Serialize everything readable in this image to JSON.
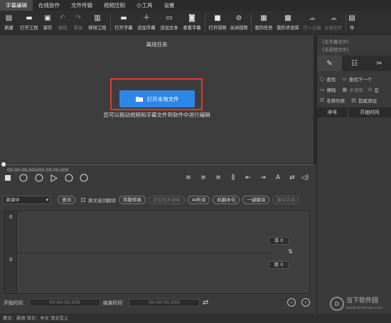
{
  "menu": [
    "字幕编辑",
    "在线协作",
    "文件传输",
    "视频压制",
    "小工具",
    "设置"
  ],
  "toolbar": [
    {
      "label": "新建",
      "icon": "new-file-icon"
    },
    {
      "label": "打开工程",
      "icon": "open-folder-icon"
    },
    {
      "label": "保存",
      "icon": "save-icon"
    },
    {
      "label": "撤销",
      "icon": "undo-icon",
      "disabled": true
    },
    {
      "label": "重做",
      "icon": "redo-icon",
      "disabled": true
    },
    {
      "label": "移除工程",
      "icon": "trash-icon"
    },
    {
      "label": "打开字幕",
      "icon": "open-subtitle-icon"
    },
    {
      "label": "追加字幕",
      "icon": "add-subtitle-icon"
    },
    {
      "label": "追加文本",
      "icon": "add-text-icon"
    },
    {
      "label": "查看字幕",
      "icon": "view-subtitle-icon"
    },
    {
      "label": "打开视频",
      "icon": "video-camera-icon"
    },
    {
      "label": "关闭视频",
      "icon": "close-video-icon"
    },
    {
      "label": "我的任务",
      "icon": "task-icon"
    },
    {
      "label": "我的术语库",
      "icon": "glossary-icon"
    },
    {
      "label": "存入云端",
      "icon": "cloud-upload-icon",
      "disabled": true
    },
    {
      "label": "云端文件",
      "icon": "cloud-file-icon",
      "disabled": true
    },
    {
      "label": "导",
      "icon": "export-icon"
    }
  ],
  "preview": {
    "title": "离线任务",
    "open_button": "打开本地文件",
    "hint": "您可以拖动视频和字幕文件到软件中进行编辑"
  },
  "timeline": {
    "time": "00:00:00,000/00:00:00,000"
  },
  "translate": {
    "mode": "英译中",
    "query": "查词",
    "checkbox_label": "原文选词翻译",
    "buttons": [
      {
        "label": "简繁转换",
        "disabled": false
      },
      {
        "label": "添加到术语库",
        "disabled": true
      },
      {
        "label": "AI听译",
        "disabled": false
      },
      {
        "label": "机翻本句",
        "disabled": false
      },
      {
        "label": "一键翻译",
        "disabled": false
      },
      {
        "label": "翻译完成",
        "disabled": true
      }
    ]
  },
  "editor": {
    "top_index": "0",
    "bottom_index": "0",
    "translation_badge": "译 0",
    "original_badge": "原 0"
  },
  "timerow": {
    "start_label": "开始时间",
    "start_value": "00:00:00,000",
    "end_label": "结束时间",
    "end_value": "00:00:00,000"
  },
  "status": "原文：英语  译文：中文    译文在上",
  "right_panel": {
    "subtitle_file": "《无字幕文件》",
    "video_file": "《无视频文件》",
    "find": "查找",
    "find_next": "查找下一个",
    "erase": "擦除",
    "glossary": "术语库",
    "name_list": "名称列表",
    "head_tail_add": "首尾添加",
    "col_index": "序号",
    "col_start": "开始时间",
    "partial_label": "在"
  },
  "watermark": {
    "line1": "当下软件园",
    "line2": "www.downxia.com"
  }
}
